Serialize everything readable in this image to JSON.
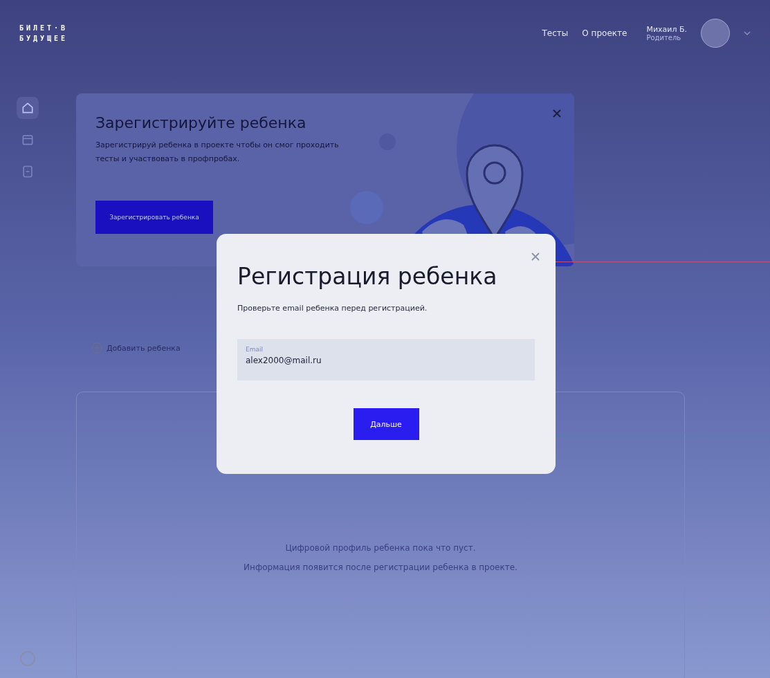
{
  "header": {
    "logo": [
      "БИЛЕТ·В",
      "БУДУЩЕЕ"
    ],
    "nav": [
      "Тесты",
      "О проекте"
    ],
    "user": {
      "name": "Михаил Б.",
      "role": "Родитель"
    }
  },
  "sidebar": {
    "items": [
      {
        "kind": "home",
        "selected": true
      },
      {
        "kind": "calendar",
        "selected": false
      },
      {
        "kind": "document",
        "selected": false
      }
    ]
  },
  "banner": {
    "title": "Зарегистрируйте ребенка",
    "text": "Зарегистрируй ребенка в проекте чтобы он смог проходить тесты и участвовать в профпробах.",
    "button": "Зарегистрировать ребенка"
  },
  "add_child": "Добавить ребенка",
  "empty_state": [
    "Цифровой профиль ребенка пока что пуст.",
    "Информация появится после регистрации ребенка в проекте."
  ],
  "modal": {
    "title": "Регистрация ребенка",
    "subtitle": "Проверьте email ребенка перед регистрацией.",
    "field": {
      "label": "Email",
      "value": "alex2000@mail.ru"
    },
    "button": "Дальше"
  }
}
